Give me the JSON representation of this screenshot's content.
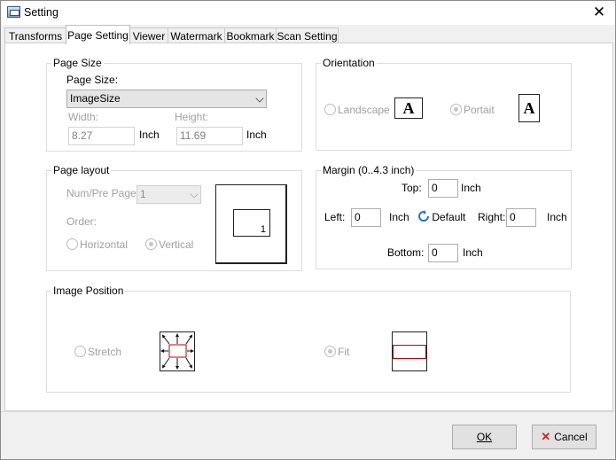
{
  "window": {
    "title": "Setting",
    "close_glyph": "✕"
  },
  "tabs": [
    {
      "label": "Transforms"
    },
    {
      "label": "Page Setting"
    },
    {
      "label": "Viewer"
    },
    {
      "label": "Watermark"
    },
    {
      "label": "Bookmark"
    },
    {
      "label": "Scan Setting"
    }
  ],
  "page_size": {
    "group_title": "Page Size",
    "label": "Page Size:",
    "selected": "ImageSize",
    "width_label": "Width:",
    "width_value": "8.27",
    "height_label": "Height:",
    "height_value": "11.69",
    "unit": "Inch"
  },
  "orientation": {
    "group_title": "Orientation",
    "landscape_label": "Landscape",
    "portrait_label": "Portait",
    "icon_letter": "A"
  },
  "page_layout": {
    "group_title": "Page layout",
    "num_per_page_label": "Num/Pre Page",
    "num_per_page_value": "1",
    "order_label": "Order:",
    "horizontal_label": "Horizontal",
    "vertical_label": "Vertical",
    "preview_number": "1"
  },
  "margin": {
    "group_title": "Margin (0..4.3 inch)",
    "top_label": "Top:",
    "top_value": "0",
    "left_label": "Left:",
    "left_value": "0",
    "right_label": "Right:",
    "right_value": "0",
    "bottom_label": "Bottom:",
    "bottom_value": "0",
    "unit": "Inch",
    "default_label": "Default"
  },
  "image_position": {
    "group_title": "Image Position",
    "stretch_label": "Stretch",
    "fit_label": "Fit"
  },
  "buttons": {
    "ok": "OK",
    "cancel": "Cancel"
  },
  "colors": {
    "fit_box": "#c00000",
    "cancel_icon": "#d32020",
    "default_icon": "#2f6fd0"
  }
}
